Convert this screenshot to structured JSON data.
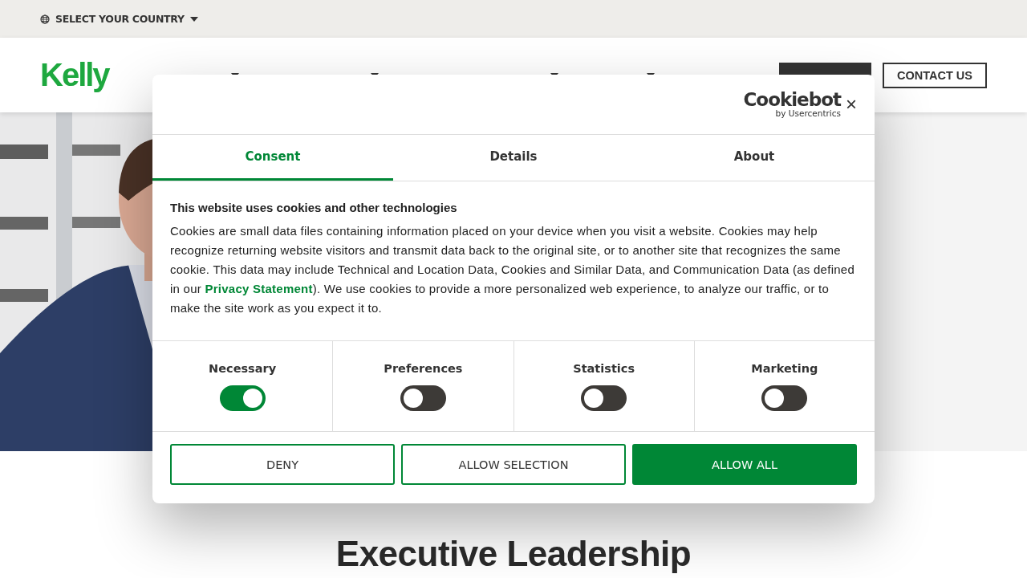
{
  "top_bar": {
    "country_selector": "SELECT YOUR COUNTRY"
  },
  "header": {
    "logo": "Kelly",
    "buttons": [
      {
        "kind": "filled"
      },
      {
        "label": "CONTACT US",
        "kind": "outline"
      }
    ]
  },
  "page_heading": "Executive Leadership",
  "cookie_dialog": {
    "brand": "Cookiebot",
    "brand_sub": "by Usercentrics",
    "close": "×",
    "tabs": [
      {
        "label": "Consent",
        "selected": true
      },
      {
        "label": "Details",
        "selected": false
      },
      {
        "label": "About",
        "selected": false
      }
    ],
    "heading": "This website uses cookies and other technologies",
    "body": "Cookies are small data files containing information placed on your device when you visit a website. Cookies may help recognize returning website visitors and transmit data back to the original site, or to another site that recognizes the same cookie. This data may include Technical and Location Data, Cookies and Similar Data, and Communication Data (as defined in our ",
    "link": "Privacy Statement",
    "body_end": "). We use cookies to provide a more personalized web experience, to analyze our traffic, or to make the site work as you expect it to.",
    "toggles": [
      {
        "label": "Necessary",
        "on": true
      },
      {
        "label": "Preferences",
        "on": false
      },
      {
        "label": "Statistics",
        "on": false
      },
      {
        "label": "Marketing",
        "on": false
      }
    ],
    "buttons": [
      {
        "label": "DENY",
        "kind": "outline"
      },
      {
        "label": "ALLOW SELECTION",
        "kind": "outline"
      },
      {
        "label": "ALLOW ALL",
        "kind": "filled"
      }
    ]
  }
}
